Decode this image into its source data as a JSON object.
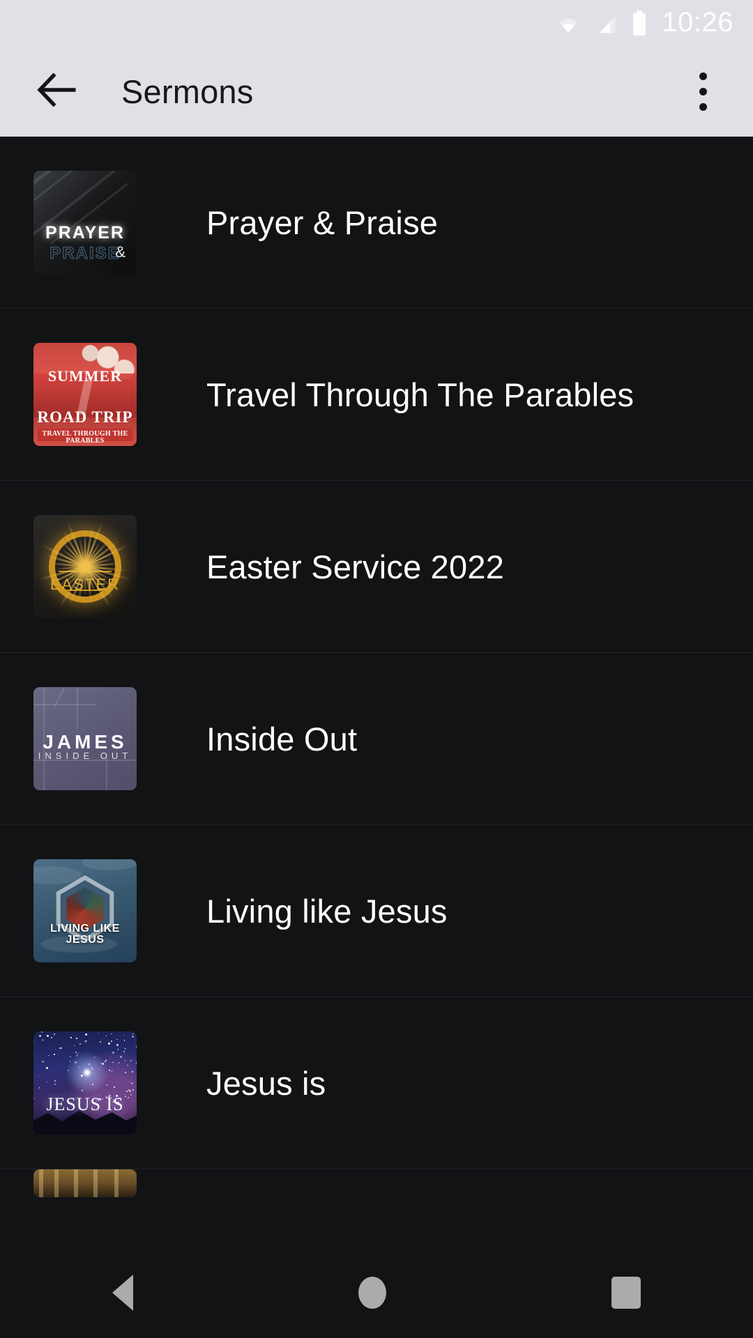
{
  "status_bar": {
    "time": "10:26",
    "icons": [
      "wifi-icon",
      "cellular-signal-icon",
      "battery-icon"
    ]
  },
  "app_bar": {
    "back_icon": "arrow-back-icon",
    "title": "Sermons",
    "overflow_icon": "more-vert-icon"
  },
  "colors": {
    "appbar_bg": "#dfe1e6",
    "appbar_text": "#17181a",
    "list_bg": "#121315",
    "list_text": "#ffffff",
    "divider": "#232427",
    "nav_icon": "#a9abad"
  },
  "list": {
    "items": [
      {
        "title": "Prayer & Praise",
        "thumb_name": "prayer-praise-artwork",
        "thumb_text": {
          "line1": "PRAYER",
          "line2": "PRAISE",
          "amp": "&"
        }
      },
      {
        "title": "Travel Through The Parables",
        "thumb_name": "summer-road-trip-artwork",
        "thumb_text": {
          "line1": "SUMMER",
          "line2": "ROAD TRIP",
          "line3": "TRAVEL THROUGH THE PARABLES"
        }
      },
      {
        "title": "Easter Service 2022",
        "thumb_name": "easter-artwork",
        "thumb_text": {
          "line1": "EASTER"
        }
      },
      {
        "title": "Inside Out",
        "thumb_name": "james-inside-out-artwork",
        "thumb_text": {
          "line1": "JAMES",
          "line2": "INSIDE OUT"
        }
      },
      {
        "title": "Living like Jesus",
        "thumb_name": "living-like-jesus-artwork",
        "thumb_text": {
          "line1": "LIVING LIKE JESUS"
        }
      },
      {
        "title": "Jesus is",
        "thumb_name": "jesus-is-artwork",
        "thumb_text": {
          "line1": "JESUS IS"
        }
      }
    ]
  },
  "nav_bar": {
    "back_label": "back-triangle-icon",
    "home_label": "home-circle-icon",
    "recents_label": "recents-square-icon"
  }
}
